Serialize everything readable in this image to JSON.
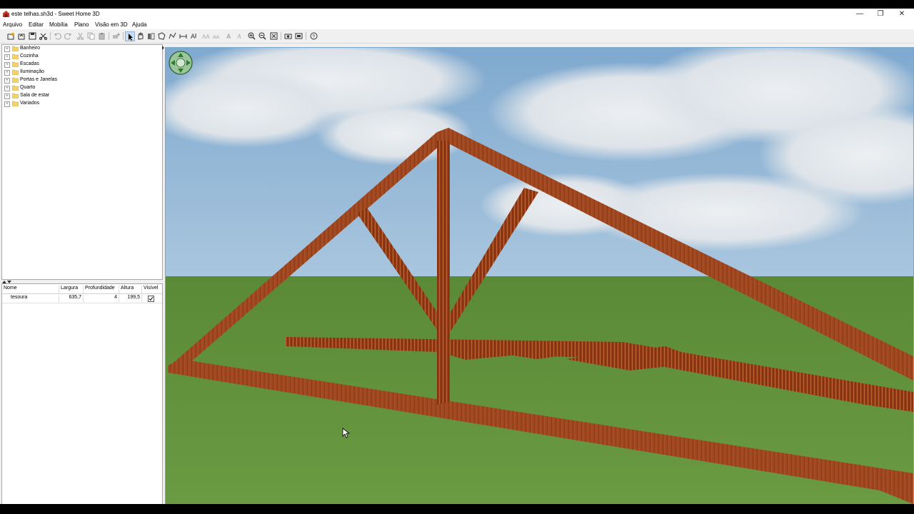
{
  "window": {
    "title": "este telhas.sh3d - Sweet Home 3D",
    "minimize_glyph": "—",
    "maximize_glyph": "❐",
    "close_glyph": "✕"
  },
  "menu": [
    "Arquivo",
    "Editar",
    "Mobília",
    "Plano",
    "Visão em 3D",
    "Ajuda"
  ],
  "toolbar_icons": [
    "new-home-icon",
    "open-icon",
    "save-icon",
    "cut-preferences-icon",
    "undo-icon",
    "redo-icon",
    "cut-icon",
    "copy-icon",
    "paste-icon",
    "add-furniture-icon",
    "select-icon",
    "pan-icon",
    "create-walls-icon",
    "create-rooms-icon",
    "create-polylines-icon",
    "create-dimensions-icon",
    "create-labels-icon",
    "increase-text-icon",
    "decrease-text-icon",
    "bold-text-icon",
    "italic-text-icon",
    "zoom-in-icon",
    "zoom-out-icon",
    "create-photo-icon",
    "create-video-icon",
    "import-icon",
    "help-icon"
  ],
  "catalog": {
    "categories": [
      "Banheiro",
      "Cozinha",
      "Escadas",
      "Iluminação",
      "Portas e Janelas",
      "Quarto",
      "Sala de estar",
      "Variados"
    ]
  },
  "furniture_table": {
    "columns": [
      "Nome",
      "Largura",
      "Profundidade",
      "Altura",
      "Visível"
    ],
    "rows": [
      {
        "name": "tesoura",
        "width": "635,7",
        "depth": "4",
        "height": "199,5",
        "visible": true
      }
    ]
  },
  "colors": {
    "wood": "#a0461e",
    "grass": "#5f8f3a",
    "sky": "#8fb4d6"
  }
}
